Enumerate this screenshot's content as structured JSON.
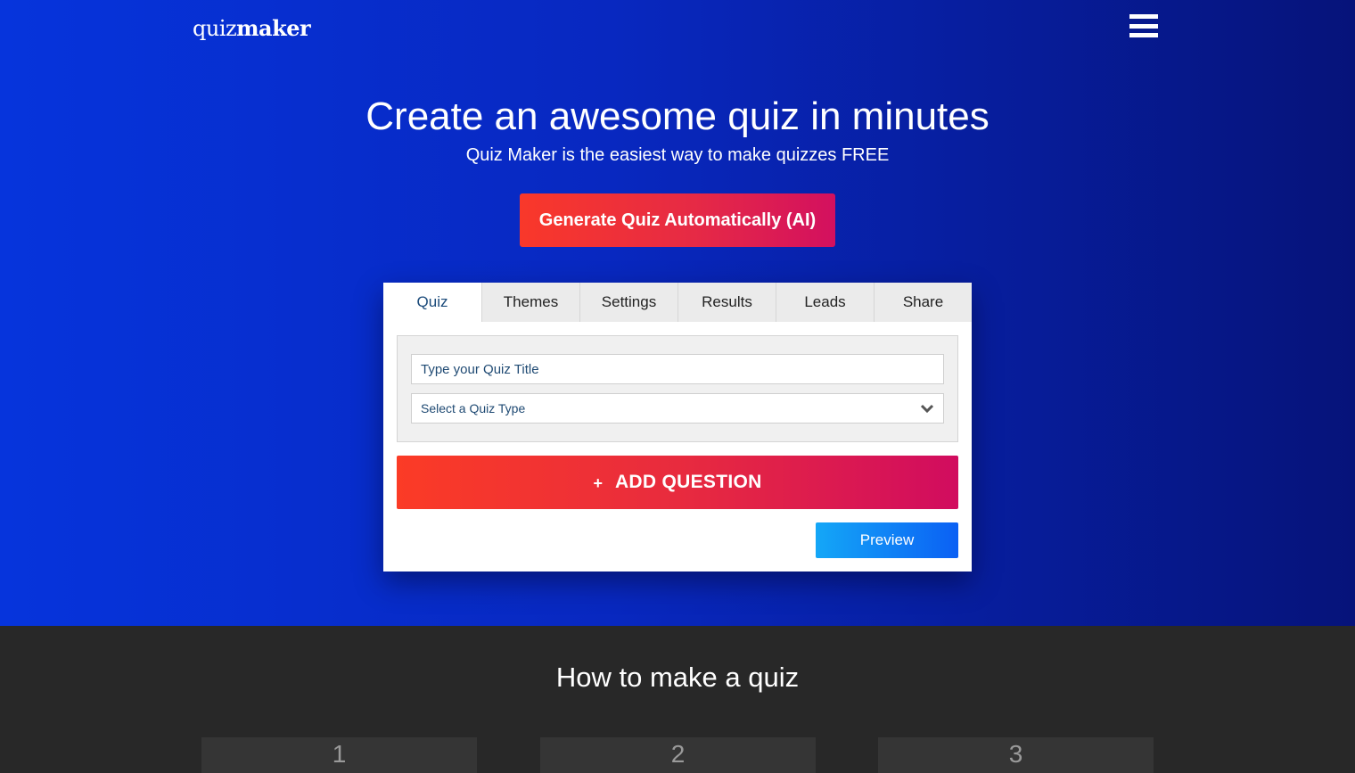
{
  "header": {
    "logo_light": "quiz",
    "logo_bold": "maker",
    "menu_icon": "hamburger-menu-icon"
  },
  "hero": {
    "title": "Create an awesome quiz in minutes",
    "subtitle": "Quiz Maker is the easiest way to make quizzes FREE",
    "ai_button": "Generate Quiz Automatically (AI)"
  },
  "editor": {
    "tabs": [
      {
        "label": "Quiz",
        "active": true
      },
      {
        "label": "Themes",
        "active": false
      },
      {
        "label": "Settings",
        "active": false
      },
      {
        "label": "Results",
        "active": false
      },
      {
        "label": "Leads",
        "active": false
      },
      {
        "label": "Share",
        "active": false
      }
    ],
    "title_input": {
      "value": "",
      "placeholder": "Type your Quiz Title"
    },
    "type_select": {
      "selected": "Select a Quiz Type"
    },
    "add_question": {
      "icon": "+",
      "label": "ADD QUESTION"
    },
    "preview_label": "Preview"
  },
  "how_to": {
    "title": "How to make a quiz",
    "steps": [
      "1",
      "2",
      "3"
    ]
  },
  "colors": {
    "hero_gradient_start": "#0634dc",
    "hero_gradient_end": "#06137a",
    "cta_red": "#f9382a",
    "cta_pink": "#d3105f",
    "preview_blue": "#0b60f4",
    "dark_section": "#282828"
  }
}
